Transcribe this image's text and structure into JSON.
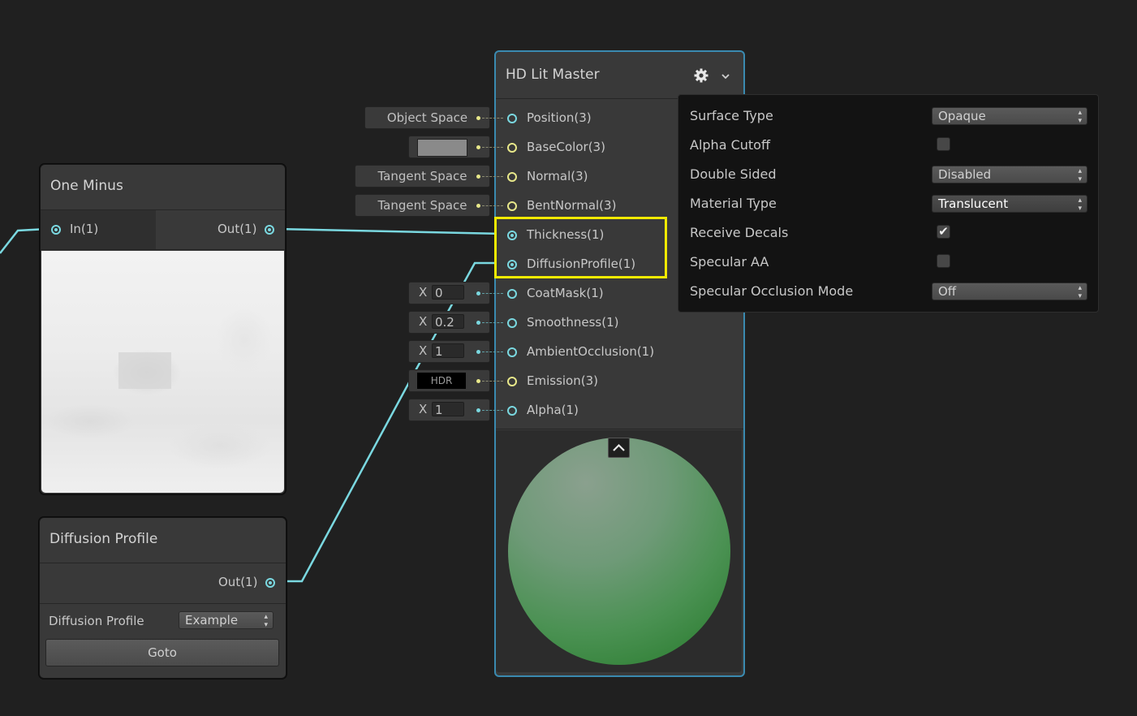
{
  "nodes": {
    "one_minus": {
      "title": "One Minus",
      "input": "In(1)",
      "output": "Out(1)"
    },
    "diffusion_profile": {
      "title": "Diffusion Profile",
      "output": "Out(1)",
      "property_label": "Diffusion Profile",
      "dropdown_value": "Example",
      "goto_label": "Goto"
    },
    "master": {
      "title": "HD Lit Master",
      "slots": [
        {
          "label": "Position(3)",
          "input": "Object Space"
        },
        {
          "label": "BaseColor(3)",
          "input": ""
        },
        {
          "label": "Normal(3)",
          "input": "Tangent Space"
        },
        {
          "label": "BentNormal(3)",
          "input": "Tangent Space"
        },
        {
          "label": "Thickness(1)",
          "input": ""
        },
        {
          "label": "DiffusionProfile(1)",
          "input": ""
        },
        {
          "label": "CoatMask(1)",
          "input_x": "X",
          "input_value": "0"
        },
        {
          "label": "Smoothness(1)",
          "input_x": "X",
          "input_value": "0.2"
        },
        {
          "label": "AmbientOcclusion(1)",
          "input_x": "X",
          "input_value": "1"
        },
        {
          "label": "Emission(3)",
          "input": "HDR"
        },
        {
          "label": "Alpha(1)",
          "input_x": "X",
          "input_value": "1"
        }
      ]
    }
  },
  "settings_popup": {
    "surface_type_label": "Surface Type",
    "surface_type_value": "Opaque",
    "alpha_cutoff_label": "Alpha Cutoff",
    "alpha_cutoff_checked": false,
    "double_sided_label": "Double Sided",
    "double_sided_value": "Disabled",
    "material_type_label": "Material Type",
    "material_type_value": "Translucent",
    "receive_decals_label": "Receive Decals",
    "receive_decals_checked": true,
    "specular_aa_label": "Specular AA",
    "specular_aa_checked": false,
    "specular_occlusion_label": "Specular Occlusion Mode",
    "specular_occlusion_value": "Off"
  },
  "colors": {
    "background": "#202020",
    "wire": "#7ad8e0",
    "highlight": "#f2ea00",
    "master_border": "#3a8ab0",
    "base_color_swatch": "#8a8a8a",
    "preview_sphere": "#3a8a45"
  },
  "icons": {
    "checkmark": "✔",
    "collapse": "^",
    "dropdown_arrows": "▴▾"
  }
}
